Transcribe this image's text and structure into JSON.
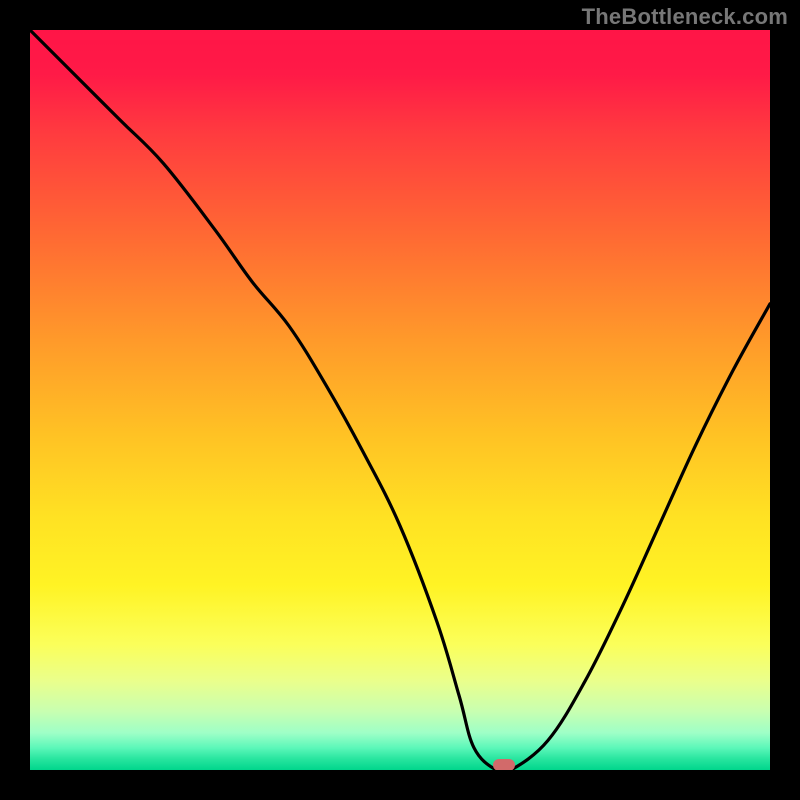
{
  "watermark": "TheBottleneck.com",
  "colors": {
    "frame": "#000000",
    "curve": "#000000",
    "marker": "#d26a6a",
    "watermark_text": "#777777"
  },
  "chart_data": {
    "type": "line",
    "title": "",
    "xlabel": "",
    "ylabel": "",
    "xlim": [
      0,
      100
    ],
    "ylim": [
      0,
      100
    ],
    "grid": false,
    "legend": false,
    "annotations": [
      "TheBottleneck.com"
    ],
    "background_gradient": {
      "top_color": "#ff1547",
      "bottom_color": "#00d68c",
      "note": "red→orange→yellow→green vertical gradient"
    },
    "series": [
      {
        "name": "bottleneck-curve",
        "x": [
          0,
          5,
          12,
          18,
          25,
          30,
          35,
          40,
          45,
          50,
          55,
          58,
          60,
          63,
          65,
          70,
          75,
          80,
          85,
          90,
          95,
          100
        ],
        "y": [
          100,
          95,
          88,
          82,
          73,
          66,
          60,
          52,
          43,
          33,
          20,
          10,
          3,
          0,
          0,
          4,
          12,
          22,
          33,
          44,
          54,
          63
        ]
      }
    ],
    "marker": {
      "name": "optimal-point",
      "x": 64,
      "y": 0,
      "shape": "rounded-pill"
    }
  }
}
